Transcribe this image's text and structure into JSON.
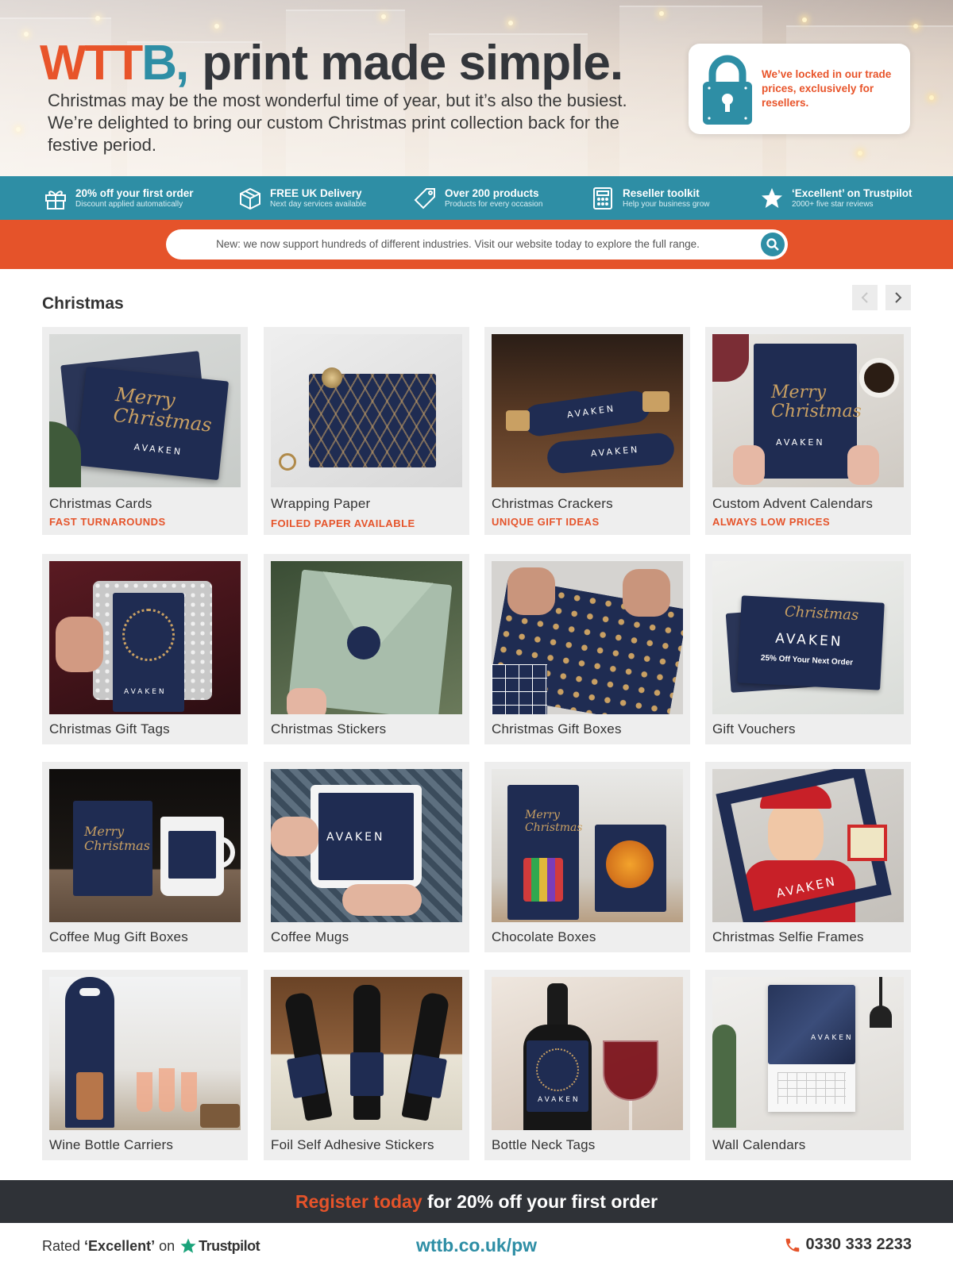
{
  "hero": {
    "logo_prefix": "WTT",
    "logo_b": "B",
    "logo_comma": ",",
    "tagline": "print made simple.",
    "intro": "Christmas may be the most wonderful time of year, but it’s also the busiest. We’re delighted to bring our custom Christmas print collection back for the festive period.",
    "lock_text": "We’ve locked in our trade prices, exclusively for resellers."
  },
  "benefits": [
    {
      "icon": "gift-icon",
      "title": "20% off your first order",
      "sub": "Discount applied automatically"
    },
    {
      "icon": "package-icon",
      "title": "FREE UK Delivery",
      "sub": "Next day services available"
    },
    {
      "icon": "tag-icon",
      "title": "Over 200 products",
      "sub": "Products for every occasion"
    },
    {
      "icon": "calculator-icon",
      "title": "Reseller toolkit",
      "sub": "Help your business grow"
    },
    {
      "icon": "star-icon",
      "title": "‘Excellent’ on Trustpilot",
      "sub": "2000+ five star reviews"
    }
  ],
  "search": {
    "placeholder": "New: we now support hundreds of different industries. Visit our website today to explore the full range."
  },
  "section": {
    "title": "Christmas"
  },
  "products": [
    {
      "name": "Christmas Cards",
      "tag": "FAST TURNAROUNDS"
    },
    {
      "name": "Wrapping Paper",
      "tag": "FOILED PAPER AVAILABLE"
    },
    {
      "name": "Christmas Crackers",
      "tag": "UNIQUE GIFT IDEAS"
    },
    {
      "name": "Custom Advent Calendars",
      "tag": "ALWAYS LOW PRICES"
    },
    {
      "name": "Christmas Gift Tags",
      "tag": ""
    },
    {
      "name": "Christmas Stickers",
      "tag": ""
    },
    {
      "name": "Christmas Gift Boxes",
      "tag": ""
    },
    {
      "name": "Gift Vouchers",
      "tag": ""
    },
    {
      "name": "Coffee Mug Gift Boxes",
      "tag": ""
    },
    {
      "name": "Coffee Mugs",
      "tag": ""
    },
    {
      "name": "Chocolate Boxes",
      "tag": ""
    },
    {
      "name": "Christmas Selfie Frames",
      "tag": ""
    },
    {
      "name": "Wine Bottle Carriers",
      "tag": ""
    },
    {
      "name": "Foil Self Adhesive Stickers",
      "tag": ""
    },
    {
      "name": "Bottle Neck Tags",
      "tag": ""
    },
    {
      "name": "Wall Calendars",
      "tag": ""
    }
  ],
  "product_art": {
    "brand": "AVAKEN",
    "merry": "Merry",
    "christmas": "Christmas",
    "voucher_offer": "25% Off Your Next Order"
  },
  "footer": {
    "register_accent": "Register today",
    "register_rest": " for 20% off your first order",
    "rated_prefix": "Rated",
    "rated_word": "‘Excellent’",
    "rated_on": "on",
    "trustpilot": "Trustpilot",
    "url": "wttb.co.uk/pw",
    "phone": "0330 333 2233"
  },
  "colors": {
    "teal": "#2e8ea5",
    "orange": "#e5532a",
    "dark": "#2f3237",
    "navy": "#1f2c52"
  }
}
